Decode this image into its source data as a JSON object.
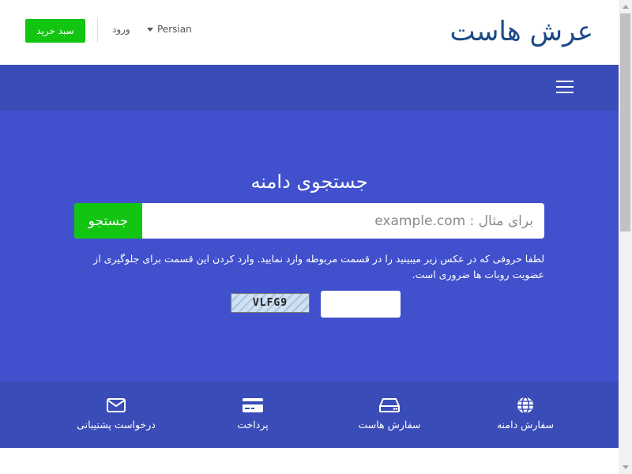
{
  "header": {
    "logo": "عرش هاست",
    "cart_button": "سبد خرید",
    "login_link": "ورود",
    "language": "Persian"
  },
  "hero": {
    "title": "جستجوی دامنه",
    "search_placeholder": "برای مثال : example.com",
    "search_button": "جستجو",
    "captcha_instructions": "لطفا حروفی که در عکس زیر میبینید را در قسمت مربوطه وارد نمایید. وارد کردن این قسمت برای جلوگیری از عضویت روبات ها ضروری است.",
    "captcha_code": "VLFG9"
  },
  "features": [
    {
      "label": "سفارش دامنه",
      "icon": "globe-icon"
    },
    {
      "label": "سفارش هاست",
      "icon": "server-icon"
    },
    {
      "label": "پرداخت",
      "icon": "credit-card-icon"
    },
    {
      "label": "درخواست پشتیبانی",
      "icon": "envelope-icon"
    }
  ],
  "colors": {
    "brand": "#1c4a86",
    "green": "#11c511",
    "nav": "#3a4cb8",
    "hero": "#4150cc"
  }
}
